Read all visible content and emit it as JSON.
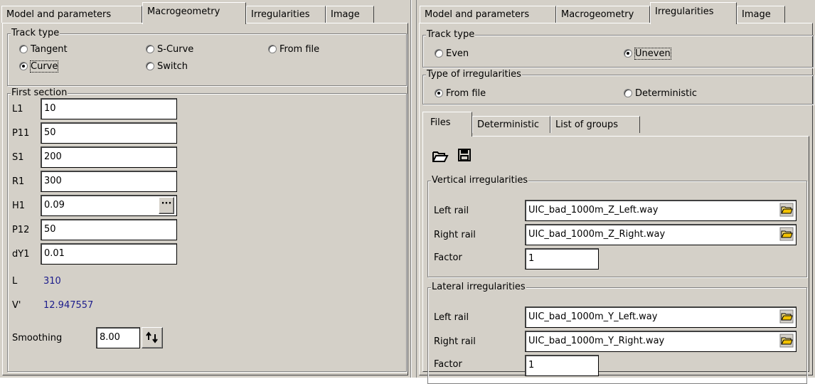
{
  "left": {
    "tabs": [
      "Model and parameters",
      "Macrogeometry",
      "Irregularities",
      "Image"
    ],
    "active_tab": 1,
    "track_type": {
      "legend": "Track type",
      "options": [
        "Tangent",
        "S-Curve",
        "From file",
        "Curve",
        "Switch"
      ],
      "selected": "Curve"
    },
    "first_section": {
      "legend": "First section",
      "fields": [
        {
          "label": "L1",
          "value": "10"
        },
        {
          "label": "P11",
          "value": "50"
        },
        {
          "label": "S1",
          "value": "200"
        },
        {
          "label": "R1",
          "value": "300"
        },
        {
          "label": "H1",
          "value": "0.09"
        },
        {
          "label": "P12",
          "value": "50"
        },
        {
          "label": "dY1",
          "value": "0.01"
        }
      ],
      "ellipsis_label": "···",
      "L": {
        "label": "L",
        "value": "310"
      },
      "V": {
        "label": "V'",
        "value": "12.947557"
      },
      "smoothing": {
        "label": "Smoothing",
        "value": "8.00"
      }
    }
  },
  "right": {
    "tabs": [
      "Model and parameters",
      "Macrogeometry",
      "Irregularities",
      "Image"
    ],
    "active_tab": 2,
    "track_type": {
      "legend": "Track type",
      "options": [
        "Even",
        "Uneven"
      ],
      "selected": "Uneven"
    },
    "type_of_irregularities": {
      "legend": "Type of irregularities",
      "options": [
        "From file",
        "Deterministic"
      ],
      "selected": "From file"
    },
    "subtabs": [
      "Files",
      "Deterministic",
      "List of groups"
    ],
    "active_subtab": 0,
    "toolbar_icons": [
      "open-folder-icon",
      "save-disk-icon"
    ],
    "vertical": {
      "legend": "Vertical irregularities",
      "left_rail": {
        "label": "Left rail",
        "value": "UIC_bad_1000m_Z_Left.way"
      },
      "right_rail": {
        "label": "Right rail",
        "value": "UIC_bad_1000m_Z_Right.way"
      },
      "factor": {
        "label": "Factor",
        "value": "1"
      }
    },
    "lateral": {
      "legend": "Lateral irregularities",
      "left_rail": {
        "label": "Left rail",
        "value": "UIC_bad_1000m_Y_Left.way"
      },
      "right_rail": {
        "label": "Right rail",
        "value": "UIC_bad_1000m_Y_Right.way"
      },
      "factor": {
        "label": "Factor",
        "value": "1"
      }
    }
  }
}
